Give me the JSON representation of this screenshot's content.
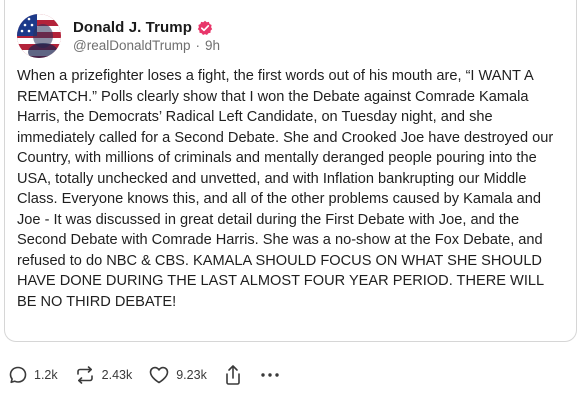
{
  "post": {
    "author_name": "Donald J. Trump",
    "handle": "@realDonaldTrump",
    "separator": "·",
    "time_ago": "9h",
    "text": "When a prizefighter loses a fight, the first words out of his mouth are, “I WANT A REMATCH.” Polls clearly show that I won the Debate against Comrade Kamala Harris, the Democrats’ Radical Left Candidate, on Tuesday night, and she immediately called for a Second Debate. She and Crooked Joe have destroyed our Country, with millions of criminals and mentally deranged people pouring into the USA, totally unchecked and unvetted, and with Inflation bankrupting our Middle Class. Everyone knows this, and all of the other problems caused by Kamala and Joe - It was discussed in great detail during the First Debate with Joe, and the Second Debate with Comrade Harris. She was a no-show at the Fox Debate, and refused to do NBC & CBS. KAMALA SHOULD FOCUS ON WHAT SHE SHOULD HAVE DONE DURING THE LAST ALMOST FOUR YEAR PERIOD. THERE WILL BE NO THIRD DEBATE!"
  },
  "actions": {
    "replies": "1.2k",
    "reposts": "2.43k",
    "likes": "9.23k"
  },
  "icons": {
    "avatar": "avatar-flag-portrait",
    "verified": "verified-badge-icon",
    "reply": "reply-bubble-icon",
    "repost": "repost-arrows-icon",
    "like": "heart-icon",
    "share": "share-upload-icon",
    "more": "more-dots-icon"
  },
  "colors": {
    "verified_badge": "#e8366a",
    "text": "#1f1f1f",
    "muted": "#6f6f6f",
    "border": "#d6d6d6"
  }
}
